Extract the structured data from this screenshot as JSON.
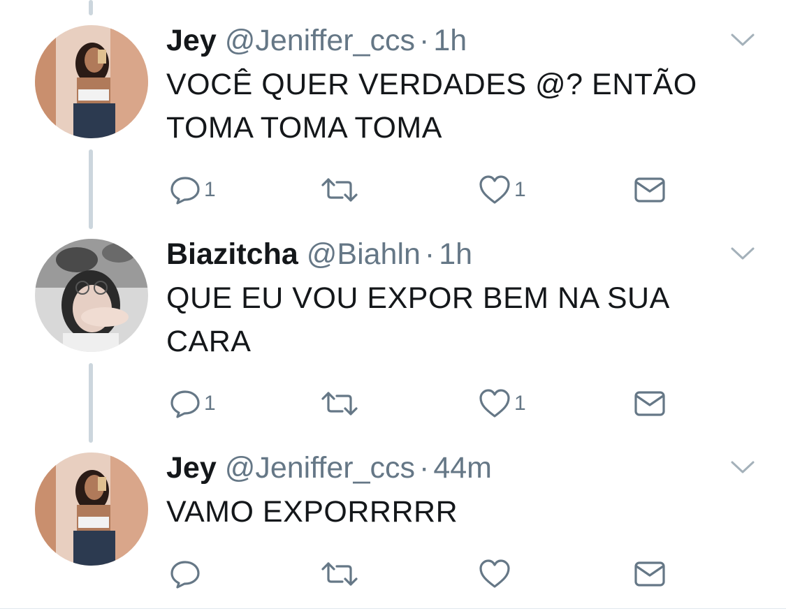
{
  "tweets": [
    {
      "name": "Jey",
      "handle": "@Jeniffer_ccs",
      "separator": "·",
      "time": "1h",
      "text": "VOCÊ QUER VERDADES @? ENTÃO TOMA TOMA TOMA",
      "reply_count": "1",
      "retweet_count": "",
      "like_count": "1"
    },
    {
      "name": "Biazitcha",
      "handle": "@Biahln",
      "separator": "·",
      "time": "1h",
      "text": "QUE EU VOU EXPOR BEM NA SUA CARA",
      "reply_count": "1",
      "retweet_count": "",
      "like_count": "1"
    },
    {
      "name": "Jey",
      "handle": "@Jeniffer_ccs",
      "separator": "·",
      "time": "44m",
      "text": "VAMO EXPORRRRR",
      "reply_count": "",
      "retweet_count": "",
      "like_count": ""
    }
  ],
  "icons": {
    "reply": "reply-icon",
    "retweet": "retweet-icon",
    "like": "heart-icon",
    "dm": "envelope-icon",
    "menu": "chevron-down-icon"
  },
  "colors": {
    "text": "#14171a",
    "secondary": "#657786",
    "thread_line": "#ccd6dd"
  }
}
